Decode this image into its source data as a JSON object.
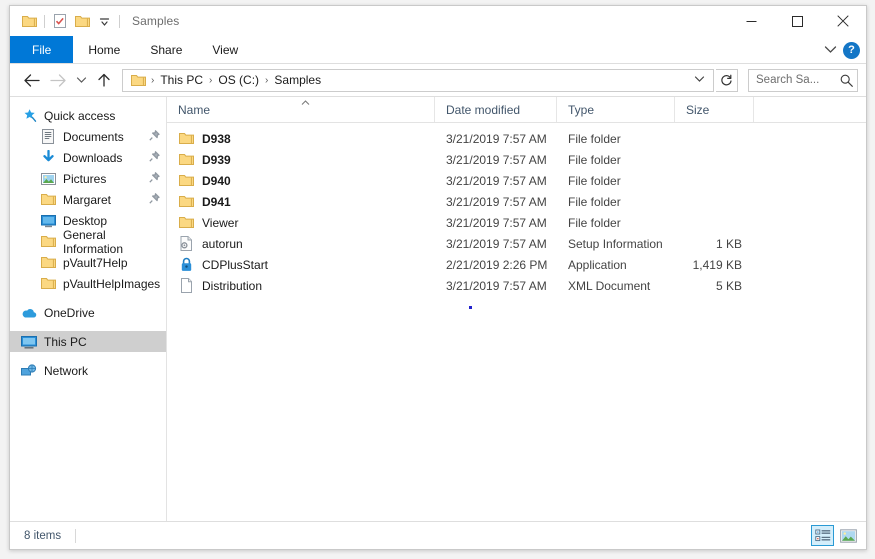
{
  "window": {
    "title": "Samples",
    "quick_access": [
      {
        "name": "folder-icon",
        "label": "Folder"
      },
      {
        "name": "properties-icon",
        "label": "Properties"
      },
      {
        "name": "new-folder-icon",
        "label": "New folder"
      },
      {
        "name": "chevron-down-icon",
        "label": "Customize Quick Access Toolbar"
      }
    ],
    "controls": {
      "minimize": "─",
      "maximize": "□",
      "close": "✕"
    }
  },
  "ribbon": {
    "tabs": [
      {
        "label": "File",
        "active": true
      },
      {
        "label": "Home",
        "active": false
      },
      {
        "label": "Share",
        "active": false
      },
      {
        "label": "View",
        "active": false
      }
    ],
    "collapse_icon": "⌄",
    "help_label": "?"
  },
  "address": {
    "back_icon": "←",
    "forward_icon": "→",
    "recent_icon": "⌄",
    "up_icon": "↑",
    "breadcrumbs": [
      "This PC",
      "OS (C:)",
      "Samples"
    ],
    "separator": "›",
    "dropdown_icon": "⌄",
    "refresh_icon": "↻"
  },
  "search": {
    "placeholder": "Search Sa...",
    "value": "",
    "icon": "search-icon"
  },
  "sidebar": {
    "items": [
      {
        "label": "Quick access",
        "icon": "star-pin-icon",
        "level": 0,
        "pinned": false,
        "selected": false
      },
      {
        "label": "Documents",
        "icon": "documents-icon",
        "level": 1,
        "pinned": true,
        "selected": false
      },
      {
        "label": "Downloads",
        "icon": "downloads-icon",
        "level": 1,
        "pinned": true,
        "selected": false
      },
      {
        "label": "Pictures",
        "icon": "pictures-icon",
        "level": 1,
        "pinned": true,
        "selected": false
      },
      {
        "label": "Margaret",
        "icon": "folder-icon",
        "level": 1,
        "pinned": true,
        "selected": false
      },
      {
        "label": "Desktop",
        "icon": "desktop-icon",
        "level": 1,
        "pinned": false,
        "selected": false
      },
      {
        "label": "General Information",
        "icon": "folder-icon",
        "level": 1,
        "pinned": false,
        "selected": false
      },
      {
        "label": "pVault7Help",
        "icon": "folder-icon",
        "level": 1,
        "pinned": false,
        "selected": false
      },
      {
        "label": "pVaultHelpImages",
        "icon": "folder-icon",
        "level": 1,
        "pinned": false,
        "selected": false
      },
      {
        "label": "OneDrive",
        "icon": "onedrive-icon",
        "level": 0,
        "pinned": false,
        "selected": false
      },
      {
        "label": "This PC",
        "icon": "thispc-icon",
        "level": 0,
        "pinned": false,
        "selected": true
      },
      {
        "label": "Network",
        "icon": "network-icon",
        "level": 0,
        "pinned": false,
        "selected": false
      }
    ]
  },
  "filelist": {
    "columns": [
      {
        "label": "Name",
        "key": "name"
      },
      {
        "label": "Date modified",
        "key": "date"
      },
      {
        "label": "Type",
        "key": "type"
      },
      {
        "label": "Size",
        "key": "size"
      }
    ],
    "sort_column": "Name",
    "sort_direction": "ascending",
    "rows": [
      {
        "name": "D938",
        "date": "3/21/2019 7:57 AM",
        "type": "File folder",
        "size": "",
        "icon": "folder-icon",
        "bold": true
      },
      {
        "name": "D939",
        "date": "3/21/2019 7:57 AM",
        "type": "File folder",
        "size": "",
        "icon": "folder-icon",
        "bold": true
      },
      {
        "name": "D940",
        "date": "3/21/2019 7:57 AM",
        "type": "File folder",
        "size": "",
        "icon": "folder-icon",
        "bold": true
      },
      {
        "name": "D941",
        "date": "3/21/2019 7:57 AM",
        "type": "File folder",
        "size": "",
        "icon": "folder-icon",
        "bold": true
      },
      {
        "name": "Viewer",
        "date": "3/21/2019 7:57 AM",
        "type": "File folder",
        "size": "",
        "icon": "folder-icon",
        "bold": false
      },
      {
        "name": "autorun",
        "date": "3/21/2019 7:57 AM",
        "type": "Setup Information",
        "size": "1 KB",
        "icon": "setup-info-icon",
        "bold": false
      },
      {
        "name": "CDPlusStart",
        "date": "2/21/2019 2:26 PM",
        "type": "Application",
        "size": "1,419 KB",
        "icon": "lock-icon",
        "bold": false
      },
      {
        "name": "Distribution",
        "date": "3/21/2019 7:57 AM",
        "type": "XML Document",
        "size": "5 KB",
        "icon": "document-icon",
        "bold": false
      }
    ]
  },
  "statusbar": {
    "item_count": "8 items",
    "view_details_label": "Details view",
    "view_large_icons_label": "Large icons view"
  },
  "colors": {
    "accent": "#0078d7",
    "folder": "#fbd882",
    "header_text": "#42566b",
    "selected_row": "#cfcfcf"
  }
}
